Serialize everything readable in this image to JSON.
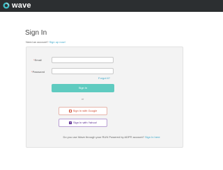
{
  "header": {
    "brand": "wave"
  },
  "signin": {
    "title": "Sign In",
    "need_account": "Need an account?",
    "signup_link": "Sign up now!"
  },
  "form": {
    "email_label": "Email",
    "email_value": "",
    "password_label": "Password",
    "password_value": "",
    "required_marker": "*",
    "forgot_link": "Forgot it?",
    "submit_label": "Sign In",
    "or_label": "or",
    "google_label": "Sign In with Google",
    "yahoo_label": "Sign In with Yahoo!"
  },
  "footer": {
    "adp_prompt": "Do you use Wave through your RUN Powered by ADP® account?",
    "adp_link": "Sign In here"
  },
  "colors": {
    "topbar": "#2c2f31",
    "brand_teal": "#3fc1c9",
    "signin_button": "#5fcbc0",
    "link": "#3aa6c8",
    "google": "#d04a30",
    "yahoo": "#5a2a91"
  },
  "icons": {
    "logo": "wave-logo-icon",
    "google": "google-icon",
    "yahoo": "yahoo-icon"
  }
}
